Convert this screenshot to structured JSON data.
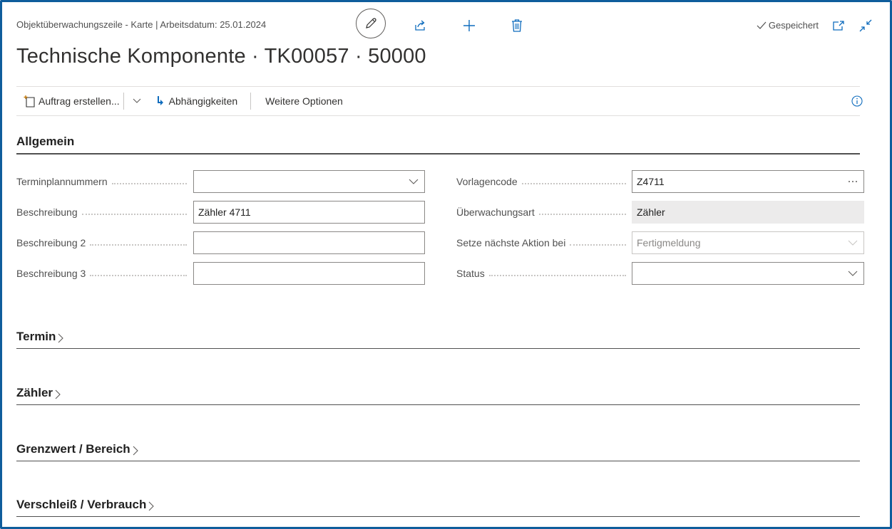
{
  "header": {
    "breadcrumb": "Objektüberwachungszeile - Karte | Arbeitsdatum: 25.01.2024",
    "saved_status": "Gespeichert",
    "title": "Technische Komponente · TK00057 · 50000"
  },
  "actions": {
    "create_order": "Auftrag erstellen...",
    "dependencies": "Abhängigkeiten",
    "more_options": "Weitere Optionen"
  },
  "sections": {
    "general": "Allgemein",
    "schedule": "Termin",
    "counter": "Zähler",
    "limit": "Grenzwert / Bereich",
    "wear": "Verschleiß / Verbrauch"
  },
  "fields": {
    "schedule_numbers": {
      "label": "Terminplannummern",
      "value": ""
    },
    "description": {
      "label": "Beschreibung",
      "value": "Zähler 4711"
    },
    "description2": {
      "label": "Beschreibung 2",
      "value": ""
    },
    "description3": {
      "label": "Beschreibung 3",
      "value": ""
    },
    "template_code": {
      "label": "Vorlagencode",
      "value": "Z4711"
    },
    "monitoring_type": {
      "label": "Überwachungsart",
      "value": "Zähler"
    },
    "next_action": {
      "label": "Setze nächste Aktion bei",
      "value": "Fertigmeldung"
    },
    "status": {
      "label": "Status",
      "value": ""
    }
  },
  "icons": {
    "edit": "pencil-icon",
    "share": "share-icon",
    "new": "plus-icon",
    "delete": "trash-icon",
    "saved": "checkmark-icon",
    "popout": "open-in-new-window-icon",
    "collapse": "collapse-icon",
    "info": "info-icon"
  },
  "colors": {
    "accent": "#0f6cbd",
    "frame": "#0f5d9c"
  }
}
